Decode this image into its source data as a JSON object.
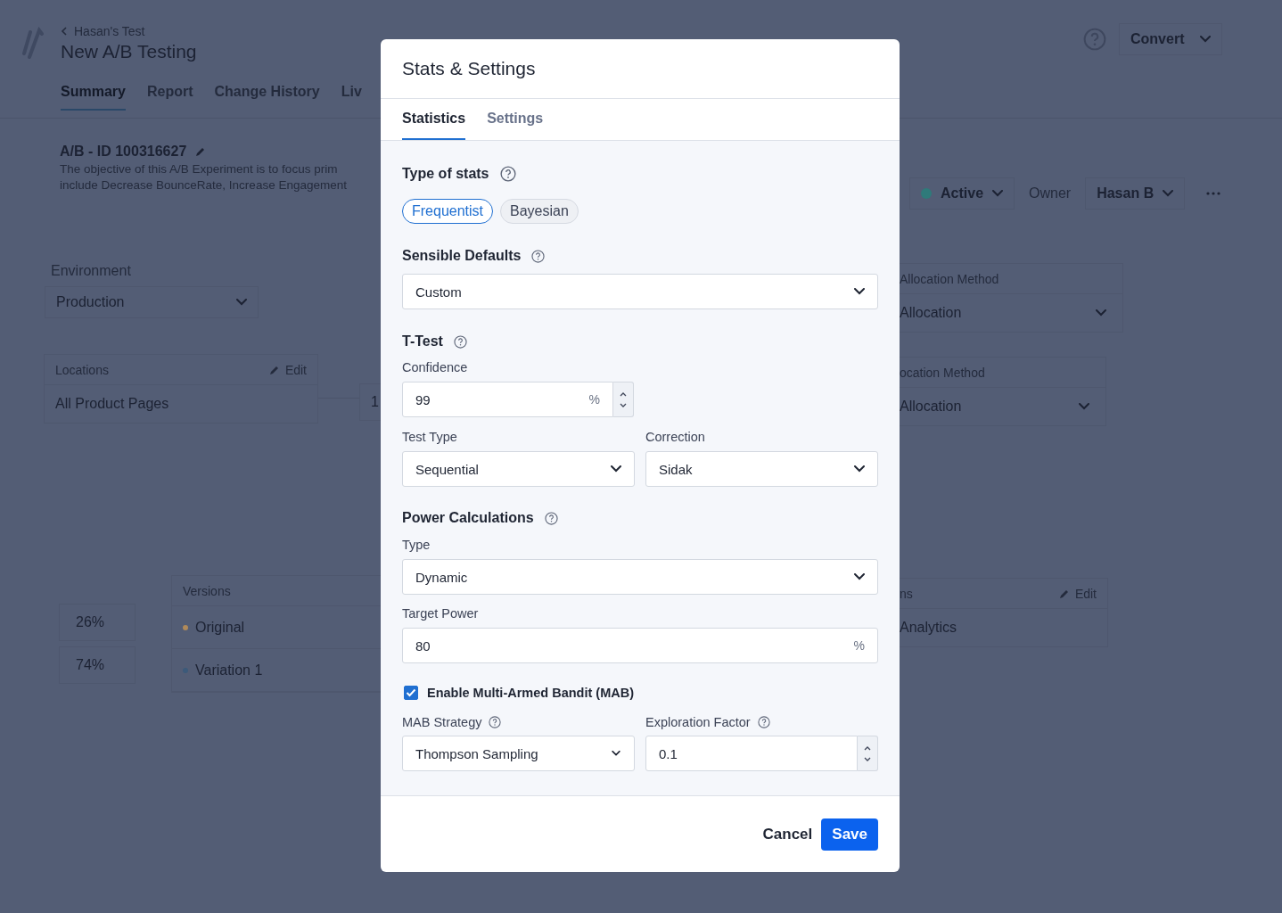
{
  "page": {
    "breadcrumb": "Hasan's Test",
    "title": "New A/B Testing",
    "tabs": [
      {
        "label": "Summary",
        "selected": true
      },
      {
        "label": "Report",
        "selected": false
      },
      {
        "label": "Change History",
        "selected": false
      },
      {
        "label": "Liv",
        "selected": false
      }
    ],
    "experiment_id": "A/B - ID 100316627",
    "description_lines": [
      "The objective of this A/B Experiment is to focus prim",
      "include Decrease BounceRate, Increase Engagement"
    ],
    "environment": {
      "label": "Environment",
      "value": "Production"
    },
    "locations": {
      "title": "Locations",
      "edit": "Edit",
      "value": "All Product Pages"
    },
    "split_value": "1",
    "traffic": [
      "26%",
      "74%"
    ],
    "versions": {
      "title": "Versions",
      "items": [
        {
          "name": "Original",
          "color": "#b08a5a"
        },
        {
          "name": "Variation 1",
          "color": "#3c5a7a"
        }
      ]
    },
    "convert_button": "Convert",
    "status": {
      "label": "Active",
      "color": "#2f7a7a"
    },
    "owner_label": "Owner",
    "owner": "Hasan B",
    "allocation_card": {
      "label": "Allocation Method",
      "value": "Allocation"
    },
    "allocation_card_2": {
      "label": "ocation Method",
      "value": "Allocation"
    },
    "integrations_card": {
      "title": "ns",
      "edit": "Edit",
      "value": "Analytics"
    }
  },
  "modal": {
    "title": "Stats & Settings",
    "tabs": [
      {
        "label": "Statistics",
        "selected": true
      },
      {
        "label": "Settings",
        "selected": false
      }
    ],
    "type_of_stats": {
      "label": "Type of stats",
      "options": [
        {
          "label": "Frequentist",
          "selected": true
        },
        {
          "label": "Bayesian",
          "selected": false
        }
      ]
    },
    "sensible_defaults": {
      "label": "Sensible Defaults",
      "value": "Custom"
    },
    "t_test": {
      "label": "T-Test",
      "confidence": {
        "label": "Confidence",
        "value": "99",
        "unit": "%"
      },
      "test_type": {
        "label": "Test Type",
        "value": "Sequential"
      },
      "correction": {
        "label": "Correction",
        "value": "Sidak"
      }
    },
    "power": {
      "label": "Power Calculations",
      "type": {
        "label": "Type",
        "value": "Dynamic"
      },
      "target_power": {
        "label": "Target Power",
        "value": "80",
        "unit": "%"
      }
    },
    "mab": {
      "label": "Enable Multi-Armed Bandit (MAB)",
      "checked": true,
      "strategy": {
        "label": "MAB Strategy",
        "value": "Thompson Sampling"
      },
      "exploration": {
        "label": "Exploration Factor",
        "value": "0.1"
      }
    },
    "cancel": "Cancel",
    "save": "Save"
  }
}
